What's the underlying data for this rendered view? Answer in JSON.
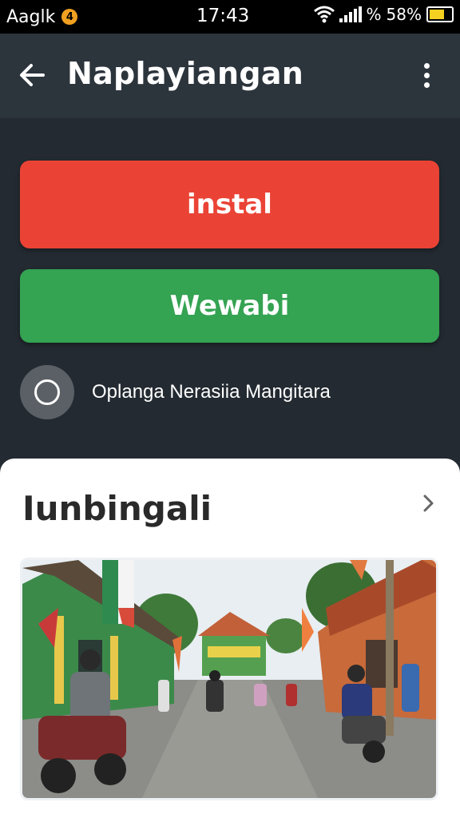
{
  "status_bar": {
    "carrier": "Aaglk",
    "notification_badge": "4",
    "time": "17:43",
    "indicators": "%",
    "battery_percent": "58%",
    "icons": [
      "wifi-icon",
      "signal-icon",
      "battery-icon"
    ]
  },
  "app_bar": {
    "title": "Naplayiangan",
    "back_icon": "arrow-left-icon",
    "menu_icon": "more-vertical-icon"
  },
  "actions": {
    "install_label": "instal",
    "install_color": "#ea4335",
    "secondary_label": "Wewabi",
    "secondary_color": "#34a352"
  },
  "option": {
    "label": "Oplanga Nerasiia Mangitara",
    "selected": false
  },
  "card": {
    "title": "Iunbingali",
    "chevron_icon": "chevron-right-icon",
    "image": "village-street-photo"
  }
}
